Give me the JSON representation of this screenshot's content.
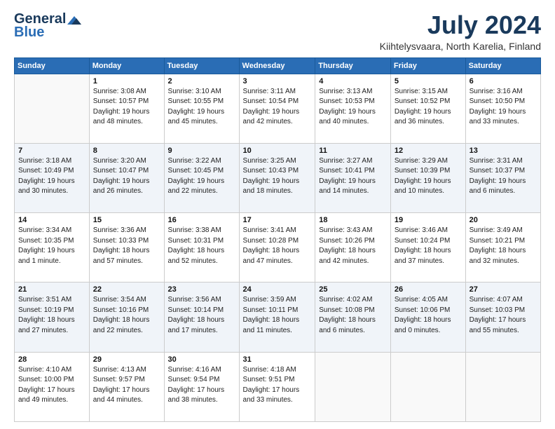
{
  "header": {
    "logo_general": "General",
    "logo_blue": "Blue",
    "month_title": "July 2024",
    "location": "Kiihtelysvaara, North Karelia, Finland"
  },
  "days_of_week": [
    "Sunday",
    "Monday",
    "Tuesday",
    "Wednesday",
    "Thursday",
    "Friday",
    "Saturday"
  ],
  "weeks": [
    [
      {
        "num": "",
        "info": ""
      },
      {
        "num": "1",
        "info": "Sunrise: 3:08 AM\nSunset: 10:57 PM\nDaylight: 19 hours\nand 48 minutes."
      },
      {
        "num": "2",
        "info": "Sunrise: 3:10 AM\nSunset: 10:55 PM\nDaylight: 19 hours\nand 45 minutes."
      },
      {
        "num": "3",
        "info": "Sunrise: 3:11 AM\nSunset: 10:54 PM\nDaylight: 19 hours\nand 42 minutes."
      },
      {
        "num": "4",
        "info": "Sunrise: 3:13 AM\nSunset: 10:53 PM\nDaylight: 19 hours\nand 40 minutes."
      },
      {
        "num": "5",
        "info": "Sunrise: 3:15 AM\nSunset: 10:52 PM\nDaylight: 19 hours\nand 36 minutes."
      },
      {
        "num": "6",
        "info": "Sunrise: 3:16 AM\nSunset: 10:50 PM\nDaylight: 19 hours\nand 33 minutes."
      }
    ],
    [
      {
        "num": "7",
        "info": "Sunrise: 3:18 AM\nSunset: 10:49 PM\nDaylight: 19 hours\nand 30 minutes."
      },
      {
        "num": "8",
        "info": "Sunrise: 3:20 AM\nSunset: 10:47 PM\nDaylight: 19 hours\nand 26 minutes."
      },
      {
        "num": "9",
        "info": "Sunrise: 3:22 AM\nSunset: 10:45 PM\nDaylight: 19 hours\nand 22 minutes."
      },
      {
        "num": "10",
        "info": "Sunrise: 3:25 AM\nSunset: 10:43 PM\nDaylight: 19 hours\nand 18 minutes."
      },
      {
        "num": "11",
        "info": "Sunrise: 3:27 AM\nSunset: 10:41 PM\nDaylight: 19 hours\nand 14 minutes."
      },
      {
        "num": "12",
        "info": "Sunrise: 3:29 AM\nSunset: 10:39 PM\nDaylight: 19 hours\nand 10 minutes."
      },
      {
        "num": "13",
        "info": "Sunrise: 3:31 AM\nSunset: 10:37 PM\nDaylight: 19 hours\nand 6 minutes."
      }
    ],
    [
      {
        "num": "14",
        "info": "Sunrise: 3:34 AM\nSunset: 10:35 PM\nDaylight: 19 hours\nand 1 minute."
      },
      {
        "num": "15",
        "info": "Sunrise: 3:36 AM\nSunset: 10:33 PM\nDaylight: 18 hours\nand 57 minutes."
      },
      {
        "num": "16",
        "info": "Sunrise: 3:38 AM\nSunset: 10:31 PM\nDaylight: 18 hours\nand 52 minutes."
      },
      {
        "num": "17",
        "info": "Sunrise: 3:41 AM\nSunset: 10:28 PM\nDaylight: 18 hours\nand 47 minutes."
      },
      {
        "num": "18",
        "info": "Sunrise: 3:43 AM\nSunset: 10:26 PM\nDaylight: 18 hours\nand 42 minutes."
      },
      {
        "num": "19",
        "info": "Sunrise: 3:46 AM\nSunset: 10:24 PM\nDaylight: 18 hours\nand 37 minutes."
      },
      {
        "num": "20",
        "info": "Sunrise: 3:49 AM\nSunset: 10:21 PM\nDaylight: 18 hours\nand 32 minutes."
      }
    ],
    [
      {
        "num": "21",
        "info": "Sunrise: 3:51 AM\nSunset: 10:19 PM\nDaylight: 18 hours\nand 27 minutes."
      },
      {
        "num": "22",
        "info": "Sunrise: 3:54 AM\nSunset: 10:16 PM\nDaylight: 18 hours\nand 22 minutes."
      },
      {
        "num": "23",
        "info": "Sunrise: 3:56 AM\nSunset: 10:14 PM\nDaylight: 18 hours\nand 17 minutes."
      },
      {
        "num": "24",
        "info": "Sunrise: 3:59 AM\nSunset: 10:11 PM\nDaylight: 18 hours\nand 11 minutes."
      },
      {
        "num": "25",
        "info": "Sunrise: 4:02 AM\nSunset: 10:08 PM\nDaylight: 18 hours\nand 6 minutes."
      },
      {
        "num": "26",
        "info": "Sunrise: 4:05 AM\nSunset: 10:06 PM\nDaylight: 18 hours\nand 0 minutes."
      },
      {
        "num": "27",
        "info": "Sunrise: 4:07 AM\nSunset: 10:03 PM\nDaylight: 17 hours\nand 55 minutes."
      }
    ],
    [
      {
        "num": "28",
        "info": "Sunrise: 4:10 AM\nSunset: 10:00 PM\nDaylight: 17 hours\nand 49 minutes."
      },
      {
        "num": "29",
        "info": "Sunrise: 4:13 AM\nSunset: 9:57 PM\nDaylight: 17 hours\nand 44 minutes."
      },
      {
        "num": "30",
        "info": "Sunrise: 4:16 AM\nSunset: 9:54 PM\nDaylight: 17 hours\nand 38 minutes."
      },
      {
        "num": "31",
        "info": "Sunrise: 4:18 AM\nSunset: 9:51 PM\nDaylight: 17 hours\nand 33 minutes."
      },
      {
        "num": "",
        "info": ""
      },
      {
        "num": "",
        "info": ""
      },
      {
        "num": "",
        "info": ""
      }
    ]
  ]
}
